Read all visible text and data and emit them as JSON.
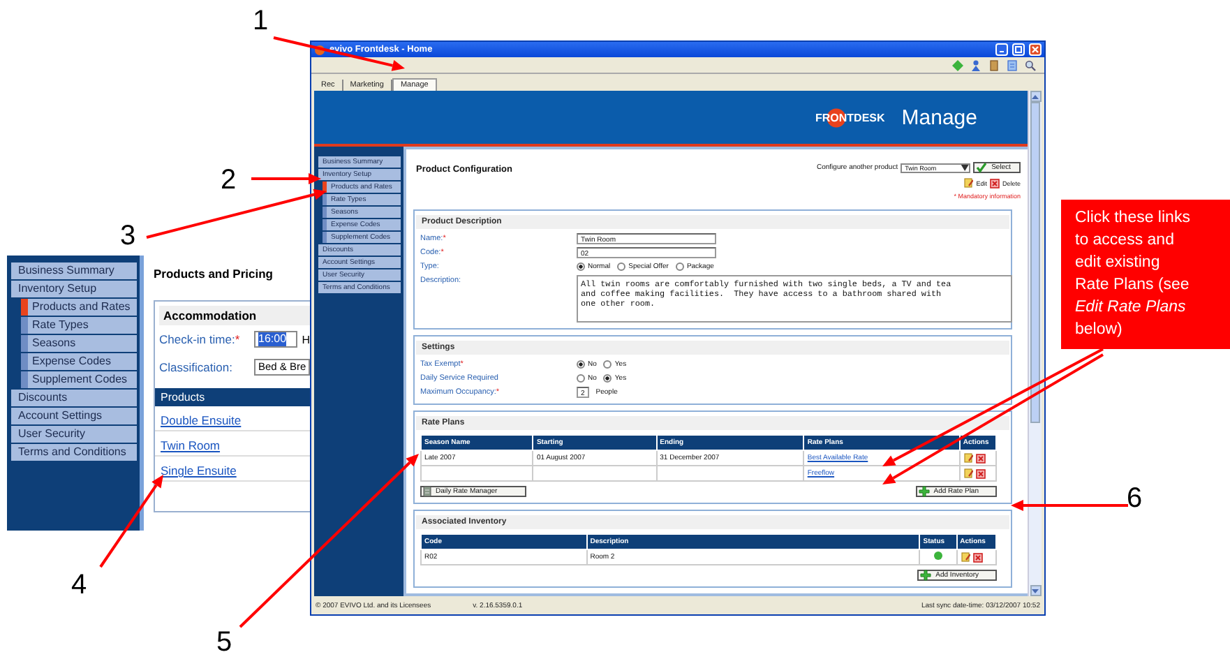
{
  "annotations": [
    {
      "label": "1"
    },
    {
      "label": "2"
    },
    {
      "label": "3"
    },
    {
      "label": "4"
    },
    {
      "label": "5"
    },
    {
      "label": "6"
    }
  ],
  "inset": {
    "sidebar": {
      "items": [
        {
          "label": "Business Summary",
          "selected": false
        },
        {
          "label": "Inventory Setup",
          "selected": false,
          "children": [
            {
              "label": "Products and Rates",
              "selected": true
            },
            {
              "label": "Rate Types",
              "selected": false
            },
            {
              "label": "Seasons",
              "selected": false
            },
            {
              "label": "Expense Codes",
              "selected": false
            },
            {
              "label": "Supplement Codes",
              "selected": false
            }
          ]
        },
        {
          "label": "Discounts",
          "selected": false
        },
        {
          "label": "Account Settings",
          "selected": false
        },
        {
          "label": "User Security",
          "selected": false
        },
        {
          "label": "Terms and Conditions",
          "selected": false
        }
      ]
    },
    "title": "Products and Pricing",
    "panel": {
      "title": "Accommodation",
      "fields": [
        {
          "kind": "time",
          "label": "Check-in time:",
          "required_mark": "*",
          "value": "16:00",
          "suffix": "H"
        },
        {
          "kind": "select",
          "label": "Classification:",
          "value": "Bed & Bre"
        }
      ],
      "products": {
        "header": "Products",
        "items": [
          {
            "label": "Double Ensuite"
          },
          {
            "label": "Twin Room"
          },
          {
            "label": "Single Ensuite"
          }
        ]
      }
    }
  },
  "window": {
    "title": "evivo Frontdesk - Home",
    "tabs": [
      {
        "label": "Rec",
        "selected": false
      },
      {
        "label": "Marketing",
        "selected": false
      },
      {
        "label": "Manage",
        "selected": true
      }
    ],
    "banner": {
      "logo": "FRONTDESK",
      "title": "Manage"
    },
    "sidebar": {
      "items": [
        {
          "label": "Business Summary",
          "selected": false
        },
        {
          "label": "Inventory Setup",
          "selected": false,
          "children": [
            {
              "label": "Products and Rates",
              "selected": true
            },
            {
              "label": "Rate Types",
              "selected": false
            },
            {
              "label": "Seasons",
              "selected": false
            },
            {
              "label": "Expense Codes",
              "selected": false
            },
            {
              "label": "Supplement Codes",
              "selected": false
            }
          ]
        },
        {
          "label": "Discounts",
          "selected": false
        },
        {
          "label": "Account Settings",
          "selected": false
        },
        {
          "label": "User Security",
          "selected": false
        },
        {
          "label": "Terms and Conditions",
          "selected": false
        }
      ]
    },
    "content": {
      "title": "Product Configuration",
      "configure": {
        "label": "Configure another product",
        "value": "Twin Room",
        "button": "Select"
      },
      "actions": [
        {
          "kind": "edit",
          "label": "Edit"
        },
        {
          "kind": "delete",
          "label": "Delete"
        }
      ],
      "mandatory_note": "* Mandatory information",
      "product_description": {
        "title": "Product Description",
        "fields": [
          {
            "kind": "text",
            "label": "Name:",
            "required_mark": "*",
            "value": "Twin Room"
          },
          {
            "kind": "text",
            "label": "Code:",
            "required_mark": "*",
            "value": "02"
          },
          {
            "kind": "radio",
            "label": "Type:",
            "options": [
              {
                "label": "Normal",
                "selected": true
              },
              {
                "label": "Special Offer",
                "selected": false
              },
              {
                "label": "Package",
                "selected": false
              }
            ]
          },
          {
            "kind": "textarea",
            "label": "Description:",
            "value": "All twin rooms are comfortably furnished with two single beds, a TV and tea and coffee making facilities.  They have access to a bathroom shared with one other room."
          }
        ]
      },
      "settings": {
        "title": "Settings",
        "fields": [
          {
            "kind": "radio",
            "label": "Tax Exempt",
            "required_mark": "*",
            "options": [
              {
                "label": "No",
                "selected": true
              },
              {
                "label": "Yes",
                "selected": false
              }
            ]
          },
          {
            "kind": "radio",
            "label": "Daily Service Required",
            "options": [
              {
                "label": "No",
                "selected": false
              },
              {
                "label": "Yes",
                "selected": true
              }
            ]
          },
          {
            "kind": "number",
            "label": "Maximum Occupancy:",
            "required_mark": "*",
            "value": "2",
            "suffix": "People"
          }
        ]
      },
      "rate_plans": {
        "title": "Rate Plans",
        "columns": [
          "Season Name",
          "Starting",
          "Ending",
          "Rate Plans",
          "Actions"
        ],
        "rows": [
          {
            "season": "Late 2007",
            "starting": "01 August 2007",
            "ending": "31 December 2007",
            "rate_plan": "Best Available Rate"
          },
          {
            "rate_plan": "Freeflow"
          }
        ],
        "buttons": [
          {
            "kind": "calendar",
            "label": "Daily Rate Manager"
          },
          {
            "kind": "add",
            "label": "Add Rate Plan"
          }
        ]
      },
      "associated_inventory": {
        "title": "Associated Inventory",
        "columns": [
          "Code",
          "Description",
          "Status",
          "Actions"
        ],
        "rows": [
          {
            "code": "R02",
            "description": "Room 2"
          }
        ],
        "buttons": [
          {
            "kind": "add",
            "label": "Add Inventory"
          }
        ]
      }
    },
    "status_bar": {
      "copyright": "© 2007 EVIVO Ltd. and its Licensees",
      "version": "v. 2.16.5359.0.1",
      "last_sync": "Last sync date-time: 03/12/2007 10:52"
    }
  },
  "callout": {
    "text": "Click these links\nto access and\nedit existing\nRate Plans (see\n*Edit Rate Plans*\nbelow)"
  }
}
